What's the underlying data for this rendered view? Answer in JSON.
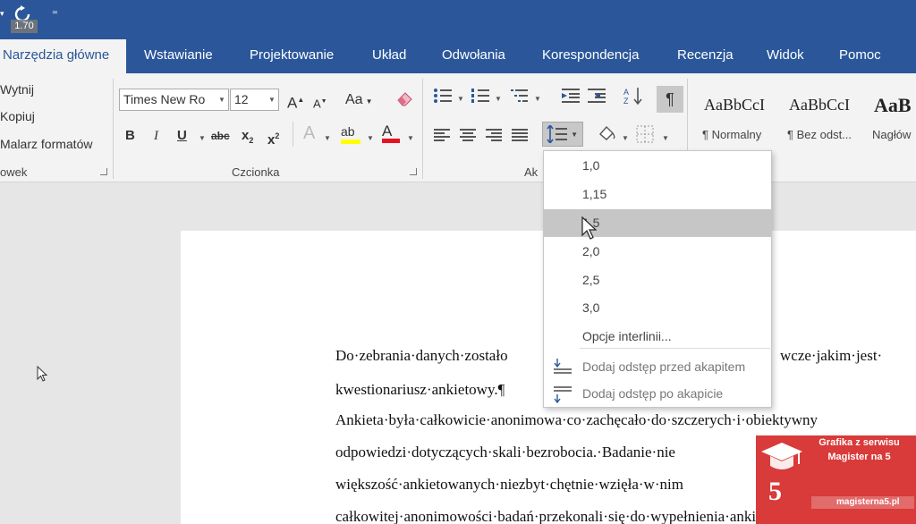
{
  "qat": {
    "zoom_badge": "1.70"
  },
  "tabs": [
    {
      "label": "Narzędzia główne"
    },
    {
      "label": "Wstawianie"
    },
    {
      "label": "Projektowanie"
    },
    {
      "label": "Układ"
    },
    {
      "label": "Odwołania"
    },
    {
      "label": "Korespondencja"
    },
    {
      "label": "Recenzja"
    },
    {
      "label": "Widok"
    },
    {
      "label": "Pomoc"
    }
  ],
  "clipboard": {
    "cut": "Wytnij",
    "copy": "Kopiuj",
    "painter": "Malarz formatów",
    "group_label": "owek"
  },
  "font": {
    "name": "Times New Ro",
    "size": "12",
    "group_label": "Czcionka",
    "change_case": "Aa",
    "bold": "B",
    "italic": "I",
    "underline": "U",
    "strike": "abc",
    "subscript": "x",
    "sub_mark": "2",
    "superscript": "x",
    "sup_mark": "2",
    "grow": "A",
    "shrink": "A",
    "effects": "A",
    "highlight": "ab",
    "color": "A"
  },
  "paragraph": {
    "group_label": "Ak",
    "show_marks": "¶"
  },
  "styles": [
    {
      "sample": "AaBbCcI",
      "name": "¶ Normalny"
    },
    {
      "sample": "AaBbCcI",
      "name": "¶ Bez odst..."
    },
    {
      "sample": "AaB",
      "name": "Nagłów"
    }
  ],
  "line_spacing_menu": {
    "options": [
      "1,0",
      "1,15",
      "1,5",
      "2,0",
      "2,5",
      "3,0"
    ],
    "more_options": "Opcje interlinii...",
    "add_before": "Dodaj odstęp przed akapitem",
    "add_after": "Dodaj odstęp po akapicie"
  },
  "document": {
    "lines": [
      "Do·zebrania·danych·zostało",
      "kwestionariusz·ankietowy.¶",
      "Ankieta·była·całkowicie·anonimowa·co·zachęcało·do·szczerych·i·obiektywny",
      "odpowiedzi·dotyczących·skali·bezrobocia.·Badanie·nie",
      "większość·ankietowanych·niezbyt·chętnie·wzięła·w·nim",
      "całkowitej·anonimowości·badań·przekonali·się·do·wypełnienia·ankiety.·Bada"
    ],
    "line1_tail": "wcze·jakim·jest·"
  },
  "watermark": {
    "line1": "Grafika z serwisu",
    "line2": "Magister na 5",
    "number": "5",
    "site": "magisterna5.pl"
  },
  "colors": {
    "accent": "#2b579a",
    "ribbon": "#f3f3f3",
    "highlight_yellow": "#ffff00",
    "font_color_red": "#e81123",
    "watermark_red": "#d93a3a"
  }
}
